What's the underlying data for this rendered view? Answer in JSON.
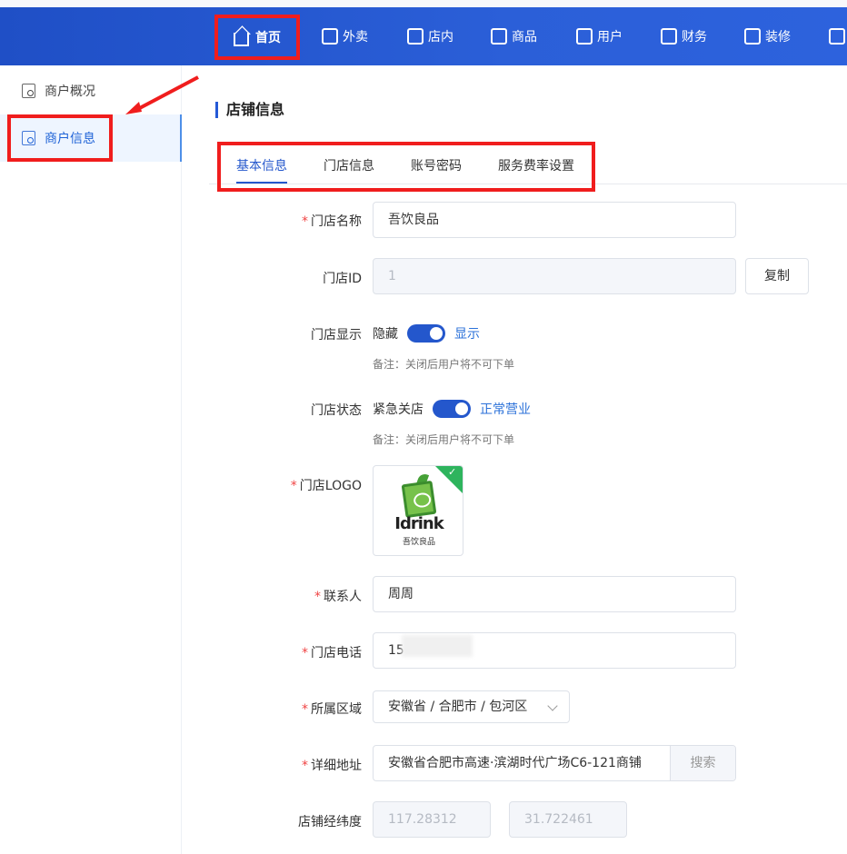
{
  "nav": {
    "items": [
      "首页",
      "外卖",
      "店内",
      "商品",
      "用户",
      "财务",
      "装修"
    ]
  },
  "sidebar": {
    "items": [
      "商户概况",
      "商户信息"
    ]
  },
  "page": {
    "title": "店铺信息",
    "tabs": [
      "基本信息",
      "门店信息",
      "账号密码",
      "服务费率设置"
    ]
  },
  "form": {
    "store_name_label": "门店名称",
    "store_name": "吾饮良品",
    "store_id_label": "门店ID",
    "store_id": "1",
    "copy": "复制",
    "display_label": "门店显示",
    "display_off": "隐藏",
    "display_on": "显示",
    "display_note": "备注：关闭后用户将不可下单",
    "status_label": "门店状态",
    "status_off": "紧急关店",
    "status_on": "正常营业",
    "status_note": "备注：关闭后用户将不可下单",
    "logo_label": "门店LOGO",
    "logo_brand": "Idrink",
    "logo_sub": "吾饮良品",
    "contact_label": "联系人",
    "contact": "周周",
    "phone_label": "门店电话",
    "phone": "15",
    "region_label": "所属区域",
    "region": "安徽省 / 合肥市 / 包河区",
    "address_label": "详细地址",
    "address": "安徽省合肥市高速·滨湖时代广场C6-121商铺",
    "search": "搜索",
    "coordinate_label": "店铺经纬度",
    "longitude": "117.28312",
    "latitude": "31.722461"
  },
  "colors": {
    "primary": "#2457cc",
    "annotation": "#f01d1d"
  }
}
